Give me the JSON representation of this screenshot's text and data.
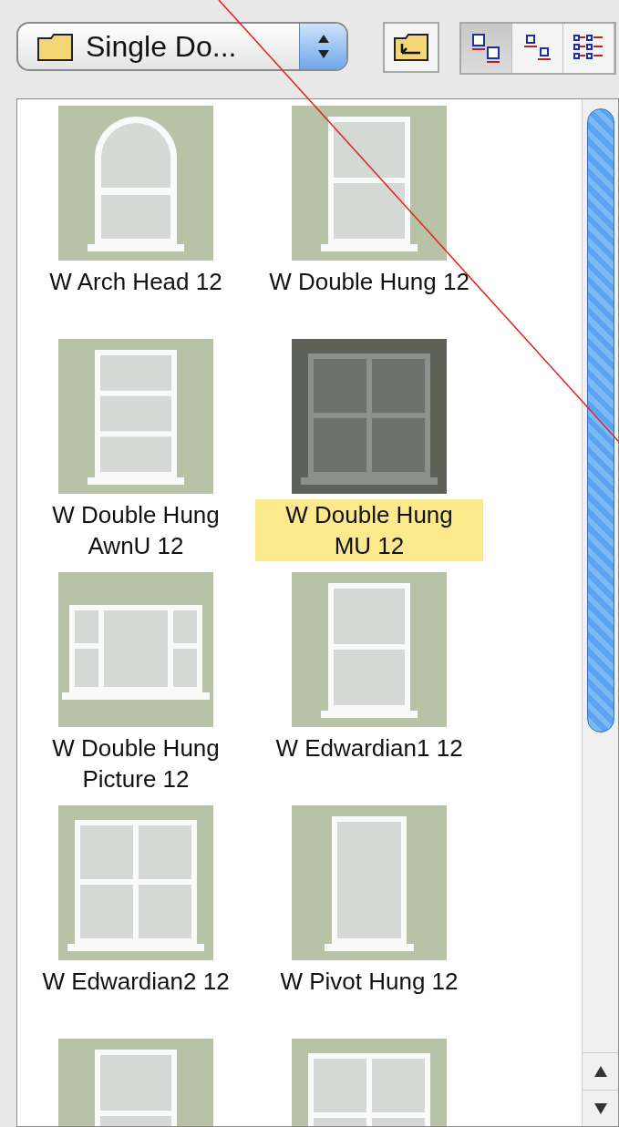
{
  "toolbar": {
    "folder_popup": {
      "label": "Single Do..."
    },
    "view_buttons": [
      {
        "kind": "large",
        "selected": true
      },
      {
        "kind": "small",
        "selected": false
      },
      {
        "kind": "list",
        "selected": false
      }
    ]
  },
  "items": [
    {
      "label": "W Arch Head 12",
      "kind": "arch",
      "selected": false
    },
    {
      "label": "W Double Hung 12",
      "kind": "double-hung",
      "selected": false
    },
    {
      "label": "W Double Hung AwnU 12",
      "kind": "awning",
      "selected": false
    },
    {
      "label": "W Double Hung MU 12",
      "kind": "mullion",
      "selected": true
    },
    {
      "label": "W Double Hung Picture 12",
      "kind": "picture",
      "selected": false
    },
    {
      "label": "W Edwardian1 12",
      "kind": "double-hung",
      "selected": false
    },
    {
      "label": "W Edwardian2 12",
      "kind": "mullion",
      "selected": false
    },
    {
      "label": "W Pivot Hung 12",
      "kind": "pivot",
      "selected": false
    },
    {
      "kind": "double-hung",
      "selected": false
    },
    {
      "kind": "mullion",
      "selected": false
    }
  ]
}
